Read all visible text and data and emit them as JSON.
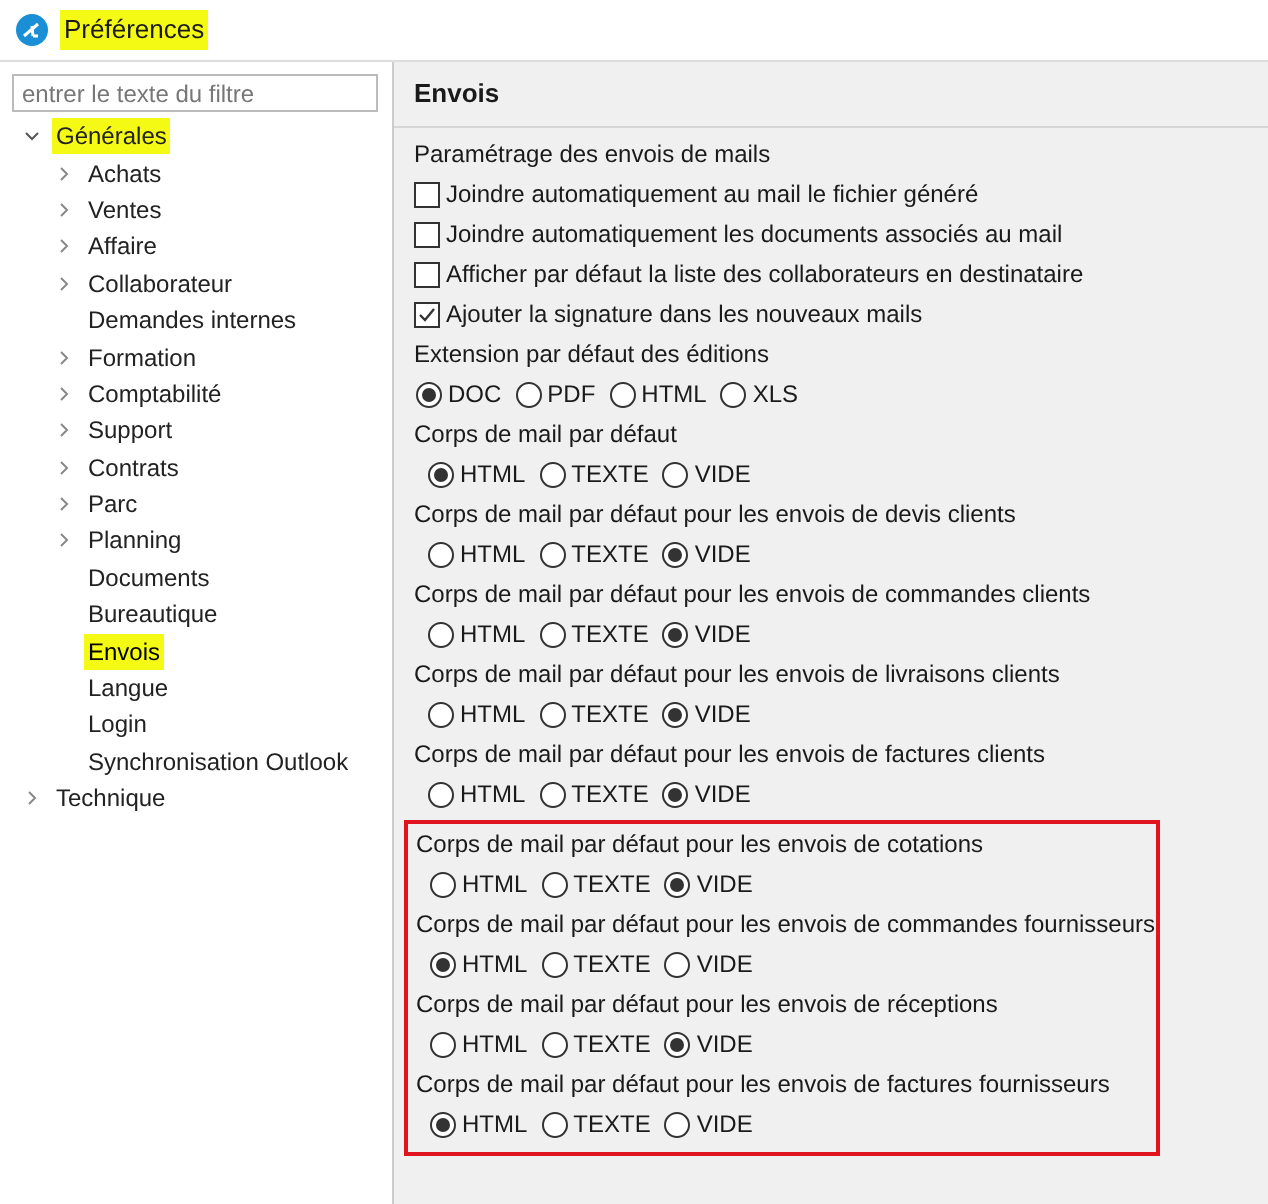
{
  "window": {
    "title": "Préférences",
    "highlighted": true
  },
  "filter": {
    "placeholder": "entrer le texte du filtre"
  },
  "tree": [
    {
      "label": "Générales",
      "expanded": true,
      "selected": false,
      "highlighted": true,
      "children": [
        {
          "label": "Achats",
          "expanded": false,
          "selected": false,
          "highlighted": false
        },
        {
          "label": "Ventes",
          "expanded": false,
          "selected": false,
          "highlighted": false
        },
        {
          "label": "Affaire",
          "expanded": false,
          "selected": false,
          "highlighted": false
        },
        {
          "label": "Collaborateur",
          "expanded": false,
          "selected": false,
          "highlighted": false
        },
        {
          "label": "Demandes internes",
          "selected": false,
          "highlighted": false
        },
        {
          "label": "Formation",
          "expanded": false,
          "selected": false,
          "highlighted": false
        },
        {
          "label": "Comptabilité",
          "expanded": false,
          "selected": false,
          "highlighted": false
        },
        {
          "label": "Support",
          "expanded": false,
          "selected": false,
          "highlighted": false
        },
        {
          "label": "Contrats",
          "expanded": false,
          "selected": false,
          "highlighted": false
        },
        {
          "label": "Parc",
          "expanded": false,
          "selected": false,
          "highlighted": false
        },
        {
          "label": "Planning",
          "expanded": false,
          "selected": false,
          "highlighted": false
        },
        {
          "label": "Documents",
          "selected": false,
          "highlighted": false
        },
        {
          "label": "Bureautique",
          "selected": false,
          "highlighted": false
        },
        {
          "label": "Envois",
          "selected": true,
          "highlighted": true
        },
        {
          "label": "Langue",
          "selected": false,
          "highlighted": false
        },
        {
          "label": "Login",
          "selected": false,
          "highlighted": false
        },
        {
          "label": "Synchronisation Outlook",
          "selected": false,
          "highlighted": false
        }
      ]
    },
    {
      "label": "Technique",
      "expanded": false,
      "selected": false,
      "highlighted": false
    }
  ],
  "page": {
    "title": "Envois",
    "sections": [
      {
        "framed": false,
        "groups": [
          {
            "kind": "checks",
            "label": "Paramétrage des envois de mails",
            "items": [
              {
                "label": "Joindre automatiquement au mail le fichier généré",
                "checked": false
              },
              {
                "label": "Joindre automatiquement les documents associés au mail",
                "checked": false
              },
              {
                "label": "Afficher par défaut la liste des collaborateurs en destinataire",
                "checked": false
              },
              {
                "label": "Ajouter la signature dans les nouveaux mails",
                "checked": true
              }
            ]
          },
          {
            "kind": "radios",
            "label": "Extension par défaut des éditions",
            "options": [
              {
                "label": "DOC",
                "selected": true
              },
              {
                "label": "PDF",
                "selected": false
              },
              {
                "label": "HTML",
                "selected": false
              },
              {
                "label": "XLS",
                "selected": false
              }
            ]
          },
          {
            "kind": "radios",
            "label": "Corps de mail par défaut",
            "options": [
              {
                "label": "HTML",
                "selected": true
              },
              {
                "label": "TEXTE",
                "selected": false
              },
              {
                "label": "VIDE",
                "selected": false
              }
            ]
          },
          {
            "kind": "radios",
            "label": "Corps de mail par défaut pour les envois de devis clients",
            "options": [
              {
                "label": "HTML",
                "selected": false
              },
              {
                "label": "TEXTE",
                "selected": false
              },
              {
                "label": "VIDE",
                "selected": true
              }
            ]
          },
          {
            "kind": "radios",
            "label": "Corps de mail par défaut pour les envois de commandes clients",
            "options": [
              {
                "label": "HTML",
                "selected": false
              },
              {
                "label": "TEXTE",
                "selected": false
              },
              {
                "label": "VIDE",
                "selected": true
              }
            ]
          },
          {
            "kind": "radios",
            "label": "Corps de mail par défaut pour les envois de livraisons clients",
            "options": [
              {
                "label": "HTML",
                "selected": false
              },
              {
                "label": "TEXTE",
                "selected": false
              },
              {
                "label": "VIDE",
                "selected": true
              }
            ]
          },
          {
            "kind": "radios",
            "label": "Corps de mail par défaut pour les envois de factures clients",
            "options": [
              {
                "label": "HTML",
                "selected": false
              },
              {
                "label": "TEXTE",
                "selected": false
              },
              {
                "label": "VIDE",
                "selected": true
              }
            ]
          }
        ]
      },
      {
        "framed": true,
        "groups": [
          {
            "kind": "radios",
            "label": "Corps de mail par défaut pour les envois de cotations",
            "options": [
              {
                "label": "HTML",
                "selected": false
              },
              {
                "label": "TEXTE",
                "selected": false
              },
              {
                "label": "VIDE",
                "selected": true
              }
            ]
          },
          {
            "kind": "radios",
            "label": "Corps de mail par défaut pour les envois de commandes fournisseurs",
            "options": [
              {
                "label": "HTML",
                "selected": true
              },
              {
                "label": "TEXTE",
                "selected": false
              },
              {
                "label": "VIDE",
                "selected": false
              }
            ]
          },
          {
            "kind": "radios",
            "label": "Corps de mail par défaut pour les envois de réceptions",
            "options": [
              {
                "label": "HTML",
                "selected": false
              },
              {
                "label": "TEXTE",
                "selected": false
              },
              {
                "label": "VIDE",
                "selected": true
              }
            ]
          },
          {
            "kind": "radios",
            "label": "Corps de mail par défaut pour les envois de factures fournisseurs",
            "options": [
              {
                "label": "HTML",
                "selected": true
              },
              {
                "label": "TEXTE",
                "selected": false
              },
              {
                "label": "VIDE",
                "selected": false
              }
            ]
          }
        ]
      }
    ]
  }
}
